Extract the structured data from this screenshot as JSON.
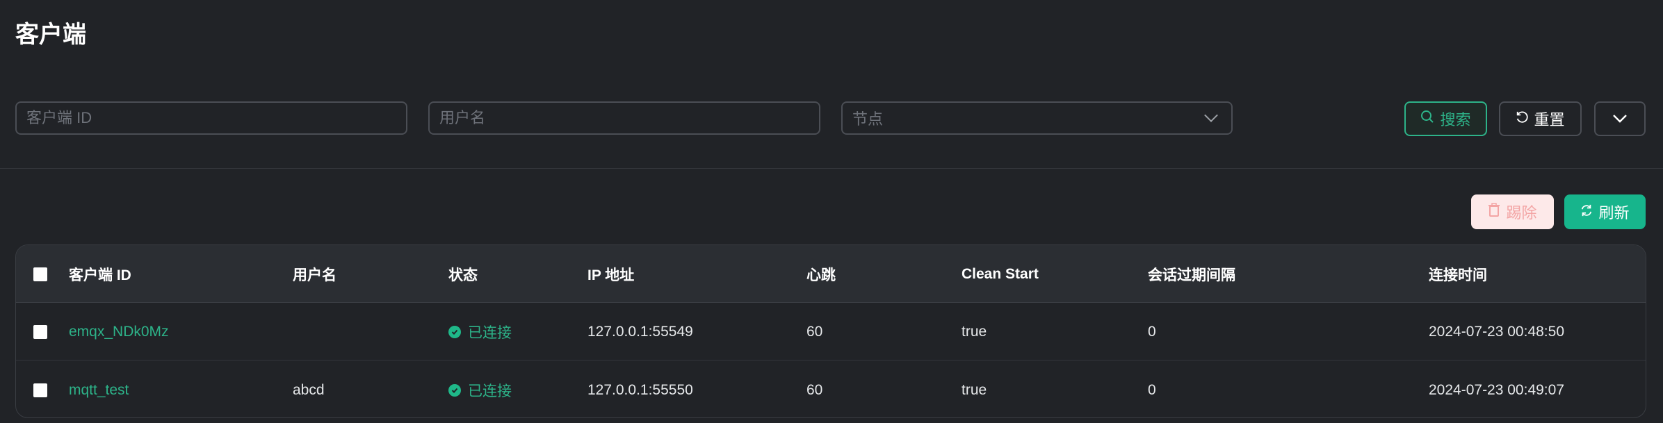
{
  "page": {
    "title": "客户端"
  },
  "filters": {
    "client_id_placeholder": "客户端 ID",
    "username_placeholder": "用户名",
    "node_placeholder": "节点",
    "search_label": "搜索",
    "reset_label": "重置"
  },
  "actions": {
    "kick_label": "踢除",
    "refresh_label": "刷新"
  },
  "table": {
    "headers": [
      "客户端 ID",
      "用户名",
      "状态",
      "IP 地址",
      "心跳",
      "Clean Start",
      "会话过期间隔",
      "连接时间"
    ],
    "rows": [
      {
        "client_id": "emqx_NDk0Mz",
        "username": "",
        "status": "已连接",
        "ip": "127.0.0.1:55549",
        "keepalive": "60",
        "clean_start": "true",
        "expiry": "0",
        "connected_at": "2024-07-23 00:48:50"
      },
      {
        "client_id": "mqtt_test",
        "username": "abcd",
        "status": "已连接",
        "ip": "127.0.0.1:55550",
        "keepalive": "60",
        "clean_start": "true",
        "expiry": "0",
        "connected_at": "2024-07-23 00:49:07"
      }
    ]
  },
  "colors": {
    "accent": "#2db389",
    "danger_bg": "#fde9e9",
    "background": "#212327"
  },
  "icons": [
    "search-icon",
    "reset-icon",
    "chevron-down-icon",
    "trash-icon",
    "refresh-icon",
    "connected-status-icon"
  ]
}
